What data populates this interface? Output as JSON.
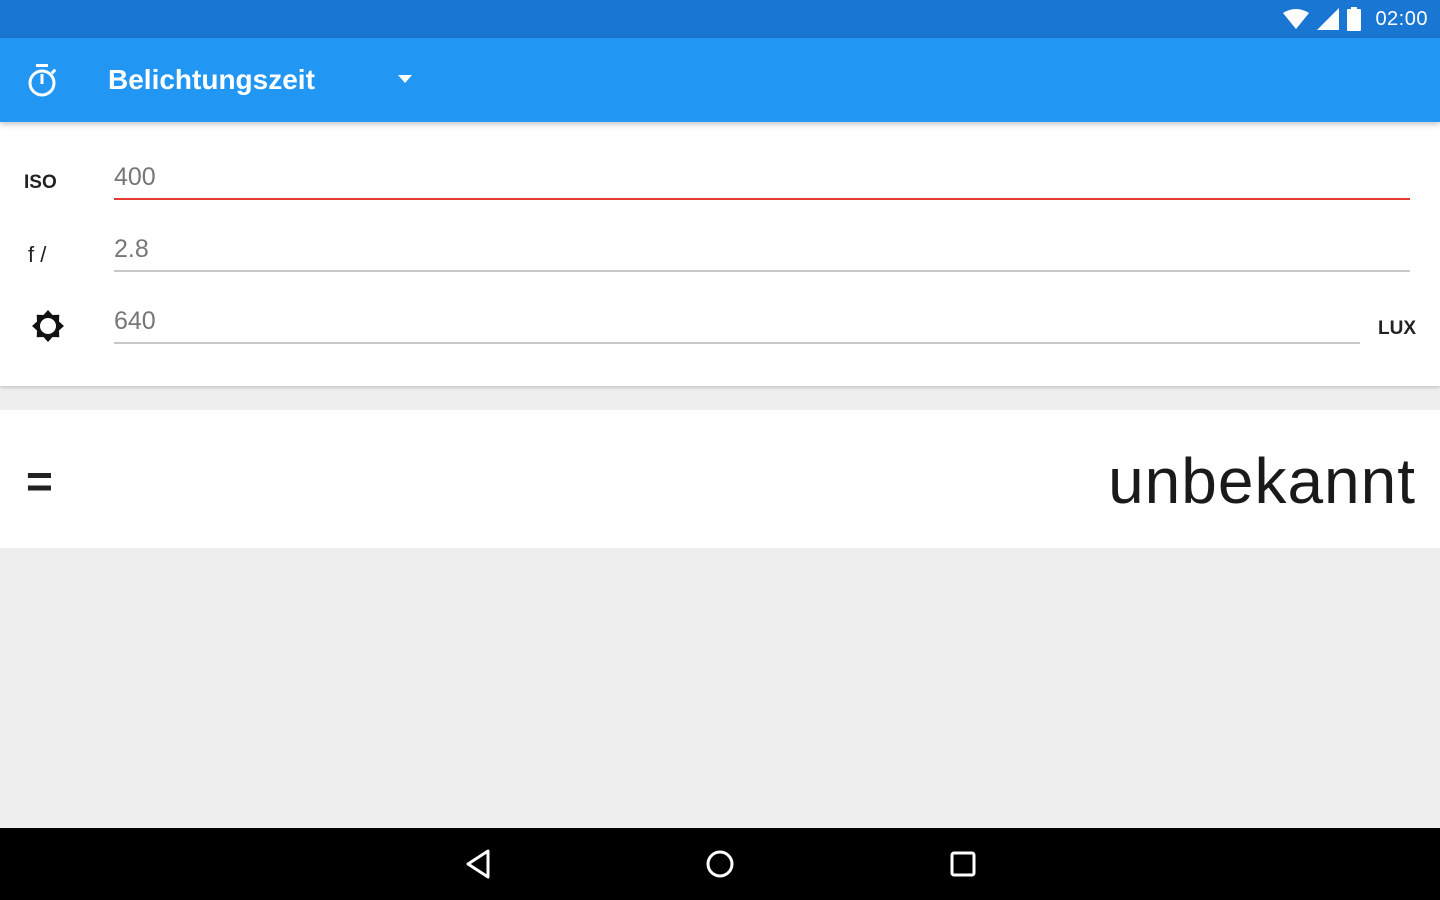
{
  "status_bar": {
    "time": "02:00",
    "icons": [
      "wifi-icon",
      "signal-icon",
      "battery-icon"
    ]
  },
  "app_bar": {
    "icon": "timer-icon",
    "spinner_label": "Belichtungszeit",
    "dropdown_icon": "dropdown-arrow-icon",
    "color": "#2196f3",
    "status_color": "#1976d2"
  },
  "inputs": {
    "iso": {
      "label": "ISO",
      "value": "400"
    },
    "aperture": {
      "label": "f /",
      "value": "2.8"
    },
    "illuminance": {
      "icon": "brightness-icon",
      "value": "640",
      "unit": "LUX"
    },
    "active_underline_color": "#e53935"
  },
  "result": {
    "equals": "=",
    "value": "unbekannt"
  },
  "nav_bar": {
    "buttons": [
      "back-icon",
      "home-icon",
      "recents-icon"
    ]
  }
}
